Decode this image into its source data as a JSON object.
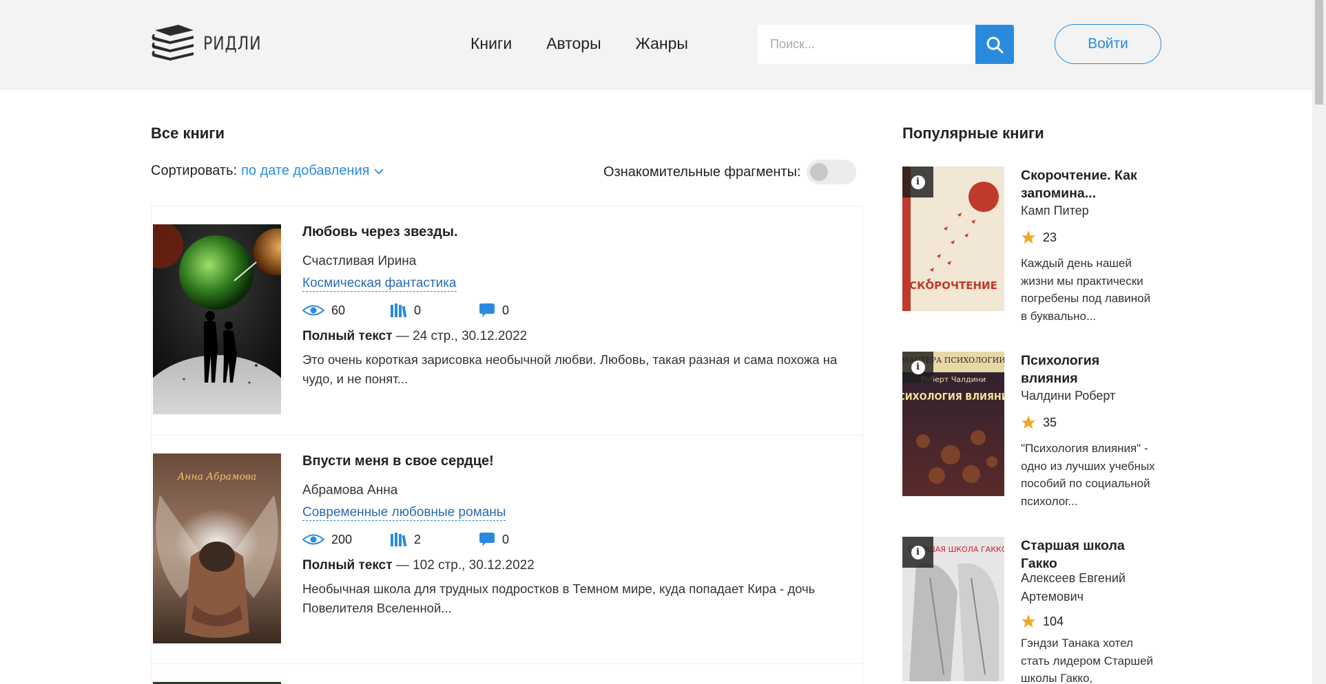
{
  "header": {
    "logo_text": "РИДЛИ",
    "nav": [
      "Книги",
      "Авторы",
      "Жанры"
    ],
    "search_placeholder": "Поиск...",
    "login_label": "Войти"
  },
  "main": {
    "title": "Все книги",
    "sort_label": "Сортировать:",
    "sort_value": "по дате добавления",
    "fragments_label": "Ознакомительные фрагменты:",
    "fragments_enabled": false,
    "books": [
      {
        "title": "Любовь через звезды.",
        "author": "Счастливая Ирина",
        "genre": "Космическая фантастика",
        "views": "60",
        "libraries": "0",
        "comments": "0",
        "full_label": "Полный текст",
        "meta": " — 24 стр., 30.12.2022",
        "description": "Это очень короткая зарисовка необычной любви. Любовь, такая разная и сама похожа на чудо, и не понят..."
      },
      {
        "title": "Впусти меня в свое сердце!",
        "author": "Абрамова Анна",
        "genre": "Современные любовные романы",
        "views": "200",
        "libraries": "2",
        "comments": "0",
        "full_label": "Полный текст",
        "meta": " — 102 стр., 30.12.2022",
        "description": "Необычная школа для трудных подростков в Темном мире, куда попадает Кира - дочь Повелителя Вселенной...",
        "cover_text": "Анна Абрамова"
      }
    ]
  },
  "sidebar": {
    "title": "Популярные книги",
    "books": [
      {
        "title": "Скорочтение. Как запомина...",
        "author": "Камп Питер",
        "rating": "23",
        "description": "Каждый день нашей жизни мы практически погребены под лавиной в буквально...",
        "cover_text": "СКОРОЧТЕНИЕ"
      },
      {
        "title": "Психология влияния",
        "author": "Чалдини Роберт",
        "rating": "35",
        "description": "\"Психология влияния\" - одно из лучших учебных пособий по социальной психолог...",
        "cover_text_top": "МАСТЕРА ПСИХОЛОГИИ",
        "cover_text_author": "Роберт Чалдини",
        "cover_text_title": "ПСИХОЛОГИЯ ВЛИЯНИЯ"
      },
      {
        "title": "Старшая школа Гакко",
        "author": "Алексеев Евгений Артемович",
        "rating": "104",
        "description": "Гэндзи Танака хотел стать лидером Старшей школы Гакко,",
        "cover_text": "СТАРШАЯ ШКОЛА ГАККО"
      }
    ]
  },
  "colors": {
    "accent": "#2a8bdc",
    "header_bg": "#f3f3f3",
    "star": "#f5a623"
  }
}
